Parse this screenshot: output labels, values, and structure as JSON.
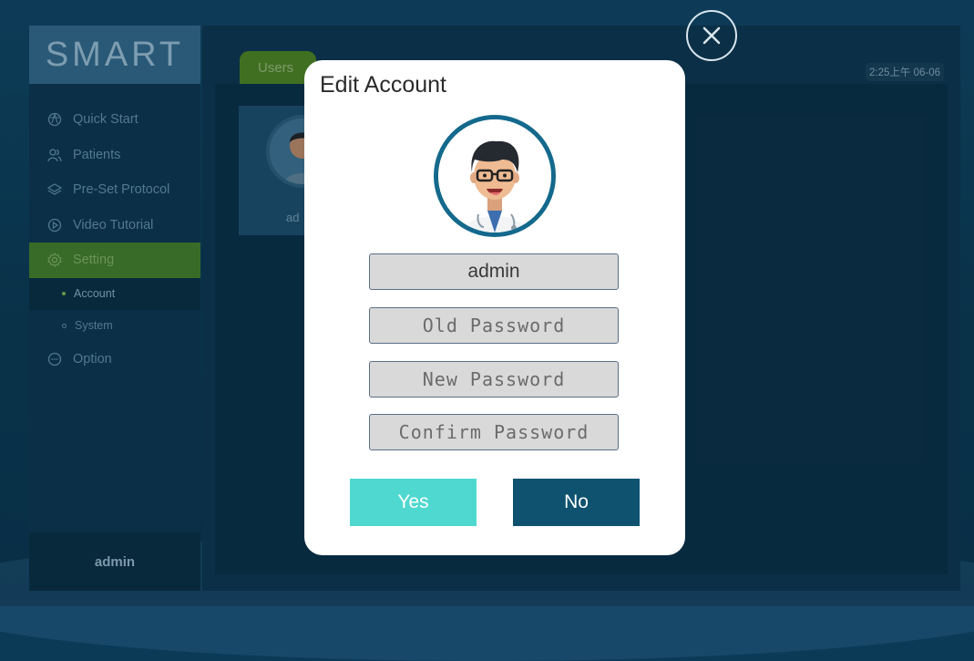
{
  "app": {
    "logo": "SMART",
    "clock": "2:25上午 06-06"
  },
  "sidebar": {
    "items": [
      {
        "label": "Quick Start",
        "icon": "quick-start-icon"
      },
      {
        "label": "Patients",
        "icon": "patients-icon"
      },
      {
        "label": "Pre-Set Protocol",
        "icon": "layers-icon"
      },
      {
        "label": "Video Tutorial",
        "icon": "play-icon"
      },
      {
        "label": "Setting",
        "icon": "gear-icon",
        "active": true
      },
      {
        "label": "Option",
        "icon": "more-icon"
      }
    ],
    "subitems": [
      {
        "label": "Account",
        "active": true
      },
      {
        "label": "System"
      }
    ],
    "footer_user": "admin"
  },
  "main": {
    "tab": "Users",
    "user_card_name": "ad"
  },
  "modal": {
    "title": "Edit Account",
    "username_value": "admin",
    "old_password_placeholder": "Old Password",
    "new_password_placeholder": "New Password",
    "confirm_password_placeholder": "Confirm Password",
    "yes_label": "Yes",
    "no_label": "No"
  },
  "colors": {
    "accent_green": "#3f7a2d",
    "yes_button": "#4fd8cf",
    "no_button": "#0e5270",
    "avatar_ring": "#14698c"
  }
}
